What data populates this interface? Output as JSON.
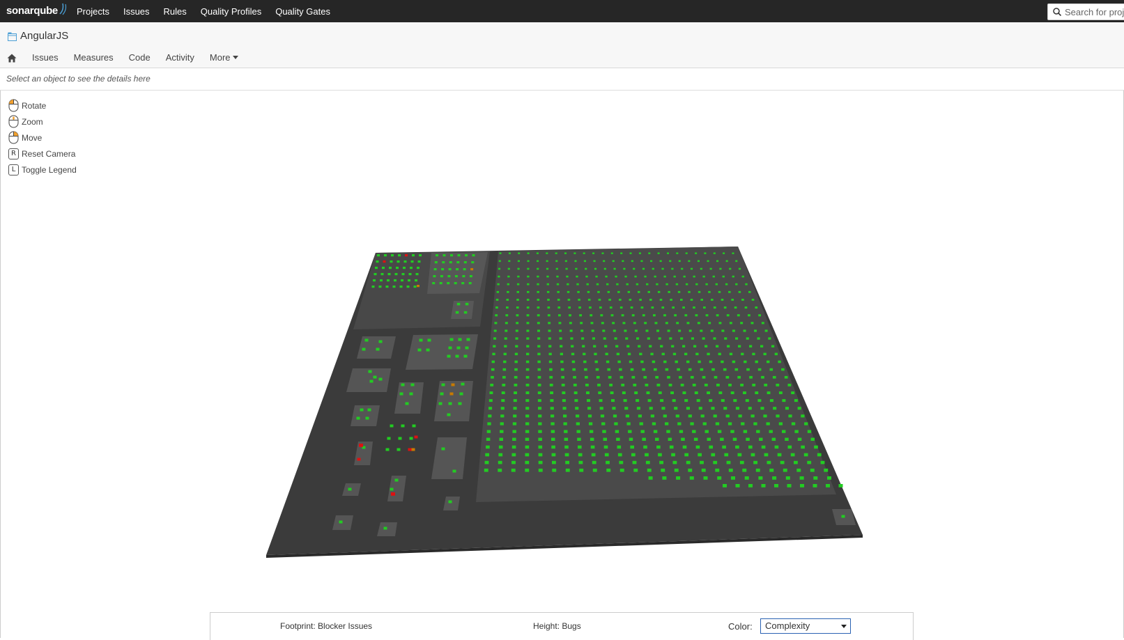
{
  "global_nav": {
    "logo_text": "sonarqube",
    "items": [
      "Projects",
      "Issues",
      "Rules",
      "Quality Profiles",
      "Quality Gates"
    ],
    "search_placeholder": "Search for projects"
  },
  "project": {
    "name": "AngularJS",
    "nav_items": [
      "Issues",
      "Measures",
      "Code",
      "Activity"
    ],
    "more_label": "More"
  },
  "details": {
    "placeholder": "Select an object to see the details here"
  },
  "controls": [
    {
      "label": "Rotate",
      "icon": "mouse-left-icon"
    },
    {
      "label": "Zoom",
      "icon": "mouse-wheel-icon"
    },
    {
      "label": "Move",
      "icon": "mouse-right-icon"
    },
    {
      "label": "Reset Camera",
      "key": "R"
    },
    {
      "label": "Toggle Legend",
      "key": "L"
    }
  ],
  "legend": {
    "footprint": "Footprint: Blocker Issues",
    "height": "Height: Bugs",
    "color_label": "Color:",
    "color_value": "Complexity"
  },
  "colors": {
    "nav_bg": "#262626",
    "platform": "#3a3a3a",
    "district": "#4a4a4a",
    "building_ok": "#22cc22",
    "building_mid": "#c87a00",
    "building_bad": "#dd1111"
  }
}
